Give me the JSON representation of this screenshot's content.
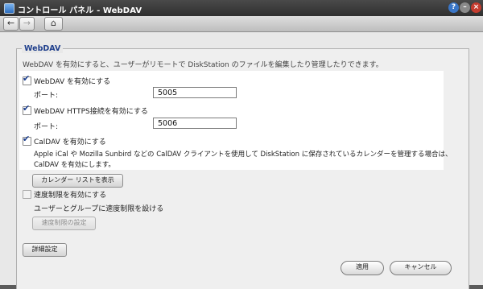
{
  "window": {
    "title": "コントロール パネル - WebDAV",
    "controls": {
      "help": "?",
      "minimize": "–",
      "close": "×"
    }
  },
  "toolbar": {
    "back_icon": "←",
    "forward_icon": "→",
    "home_icon": "⌂"
  },
  "section": {
    "title": "WebDAV",
    "description": "WebDAV を有効にすると、ユーザーがリモートで DiskStation のファイルを編集したり管理したりできます。"
  },
  "webdav": {
    "label": "WebDAV を有効にする",
    "checked": true,
    "port_label": "ポート:",
    "port_value": "5005"
  },
  "webdav_https": {
    "label": "WebDAV HTTPS接続を有効にする",
    "checked": true,
    "port_label": "ポート:",
    "port_value": "5006"
  },
  "caldav": {
    "label": "CalDAV を有効にする",
    "checked": true,
    "note_line1": "Apple iCal や Mozilla Sunbird などの CalDAV クライアントを使用して DiskStation に保存されているカレンダーを管理する場合は、",
    "note_line2": "CalDAV を有効にします。",
    "calendar_list_button": "カレンダー リストを表示"
  },
  "speed_limit": {
    "label": "速度制限を有効にする",
    "checked": false,
    "description": "ユーザーとグループに速度制限を設ける",
    "settings_button": "速度制限の設定"
  },
  "advanced_button": "詳細設定",
  "footer": {
    "apply_button": "適用",
    "cancel_button": "キャンセル"
  },
  "colors": {
    "section_title": "#1f3f8c",
    "highlight_bg": "#ffffff"
  }
}
